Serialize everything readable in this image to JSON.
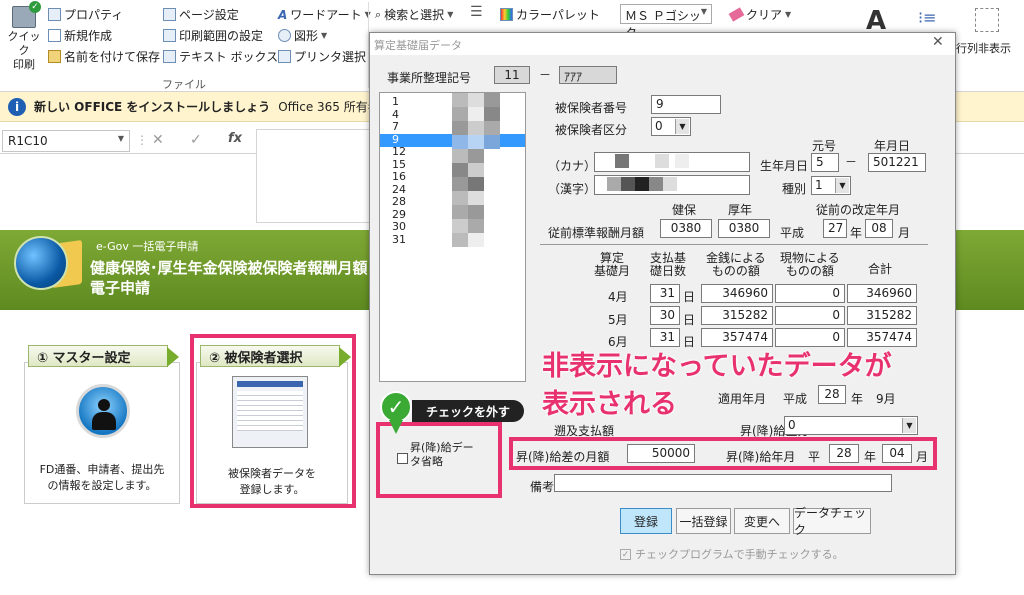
{
  "ribbon": {
    "quick_print": "クイック\n印刷",
    "properties": "プロパティ",
    "new_create": "新規作成",
    "save_as": "名前を付けて保存",
    "page_setup": "ページ設定",
    "print_area": "印刷範囲の設定",
    "text_box": "テキスト ボックス",
    "wordart": "ワードアート",
    "shapes": "図形",
    "printer_select": "プリンタ選択",
    "search_select": "検索と選択",
    "color_palette": "カラーパレット",
    "font_name": "ＭＳ Ｐゴシック",
    "clear": "クリア",
    "group_file": "ファイル",
    "row_col_hide": "行列非表示"
  },
  "infobar": {
    "bold": "新しい OFFICE をインストールしましょう",
    "text": "Office 365 所有者の特"
  },
  "formula": {
    "namebox": "R1C10",
    "fx": "fx"
  },
  "banner": {
    "sub": "e-Gov 一括電子申請",
    "title1": "健康保険･厚生年金保険被保険者報酬月額",
    "title2": "電子申請"
  },
  "steps": {
    "master_head": "① マスター設定",
    "master_text": "FD通番、申請者、提出先\nの情報を設定します。",
    "insured_head": "② 被保険者選択",
    "insured_text": "被保険者データを\n登録します。"
  },
  "dialog": {
    "title": "算定基礎届データ",
    "office_label": "事業所整理記号",
    "office_code1": "11",
    "office_code2": "ｱｱｱ",
    "list_items": [
      "1",
      "4",
      "7",
      "9",
      "12",
      "15",
      "16",
      "24",
      "28",
      "29",
      "30",
      "31"
    ],
    "selected_item": "9",
    "insured_no_label": "被保険者番号",
    "insured_no": "9",
    "insured_type_label": "被保険者区分",
    "insured_type": "0",
    "kana_label": "（カナ）",
    "kanji_label": "（漢字）",
    "era_label": "元号",
    "date_label": "年月日",
    "birth_label": "生年月日",
    "birth_era": "5",
    "birth_date": "501221",
    "kind_label": "種別",
    "kind": "1",
    "prev_label": "従前標準報酬月額",
    "health_label": "健保",
    "pension_label": "厚年",
    "prev_health": "0380",
    "prev_pension": "0380",
    "revise_label": "従前の改定年月",
    "heisei": "平成",
    "revise_year": "27",
    "year_unit": "年",
    "revise_month": "08",
    "month_unit": "月",
    "col_month": "算定\n基礎月",
    "col_days": "支払基\n礎日数",
    "col_cash": "金銭による\nものの額",
    "col_kind": "現物による\nものの額",
    "col_total": "合計",
    "day_unit": "日",
    "rows": [
      {
        "month": "4月",
        "days": "31",
        "cash": "346960",
        "kind": "0",
        "total": "346960"
      },
      {
        "month": "5月",
        "days": "30",
        "cash": "315282",
        "kind": "0",
        "total": "315282"
      },
      {
        "month": "6月",
        "days": "31",
        "cash": "357474",
        "kind": "0",
        "total": "357474"
      }
    ],
    "apply_label": "適用年月",
    "apply_heisei": "平成",
    "apply_year": "28",
    "apply_month": "9月",
    "retro_label": "遡及支払額",
    "raise_type_label": "昇(降)給区分",
    "raise_type": "0",
    "omit_label": "昇(降)給デー\nタ省略",
    "diff_label": "昇(降)給差の月額",
    "diff_value": "50000",
    "raise_date_label": "昇(降)給年月",
    "raise_era": "平",
    "raise_year": "28",
    "raise_month": "04",
    "note_label": "備考",
    "btn_register": "登録",
    "btn_bulk": "一括登録",
    "btn_change": "変更へ",
    "btn_check": "データチェック",
    "manual_check": "チェックプログラムで手動チェックする。"
  },
  "annotation": {
    "line1": "非表示になっていたデータが",
    "line2": "表示される",
    "tag": "チェックを外す"
  },
  "colors": {
    "accent": "#e8326f",
    "banner": "#6f9a28",
    "selected": "#3399ff"
  }
}
